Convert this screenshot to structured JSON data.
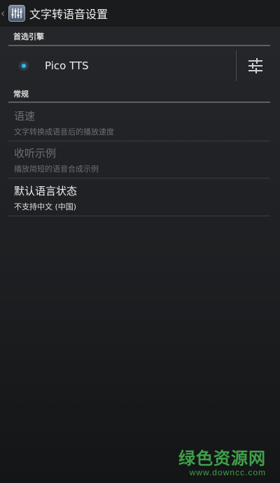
{
  "actionbar": {
    "title": "文字转语音设置",
    "up_icon": "chevron-left-icon",
    "app_icon": "equalizer-sliders-icon"
  },
  "sections": {
    "engine_header": "首选引擎",
    "general_header": "常规"
  },
  "engine": {
    "name": "Pico TTS",
    "selected": true,
    "settings_icon": "sliders-icon"
  },
  "prefs": {
    "speech_rate": {
      "title": "语速",
      "summary": "文字转换成语音后的播放速度",
      "enabled": false
    },
    "listen_example": {
      "title": "收听示例",
      "summary": "播放简短的语音合成示例",
      "enabled": false
    },
    "default_language_status": {
      "title": "默认语言状态",
      "summary": "不支持中文 (中国)",
      "enabled": true
    }
  },
  "watermark": {
    "name": "绿色资源网",
    "url": "www.downcc.com"
  },
  "colors": {
    "accent": "#33b5e5",
    "watermark": "#3fa04a",
    "background": "#1d1f22"
  }
}
